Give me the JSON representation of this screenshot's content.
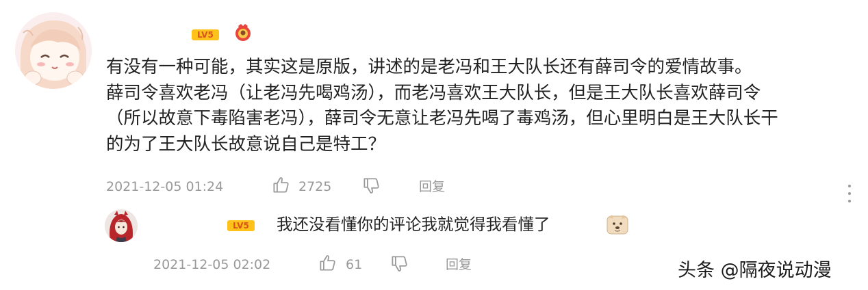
{
  "comment": {
    "level_badge": "LV5",
    "lines": [
      "有没有一种可能，其实这是原版，讲述的是老冯和王大队长还有薛司令的爱情故事。",
      "薛司令喜欢老冯（让老冯先喝鸡汤），而老冯喜欢王大队长，但是王大队长喜欢薛司令",
      "（所以故意下毒陷害老冯），薛司令无意让老冯先喝了毒鸡汤，但心里明白是王大队长干",
      "的为了王大队长故意说自己是特工？"
    ],
    "timestamp": "2021-12-05 01:24",
    "likes": "2725",
    "reply_label": "回复",
    "icons": {
      "avatar": "anime-girl-avatar",
      "medal": "medal-icon",
      "like": "thumbs-up-icon",
      "dislike": "thumbs-down-icon",
      "more": "more-vertical-icon"
    }
  },
  "reply": {
    "level_badge": "LV5",
    "text": "我还没看懂你的评论我就觉得我看懂了",
    "timestamp": "2021-12-05 02:02",
    "likes": "61",
    "reply_label": "回复",
    "icons": {
      "avatar": "red-hair-character-avatar",
      "emoji": "doge-emoji-icon",
      "like": "thumbs-up-icon",
      "dislike": "thumbs-down-icon"
    }
  },
  "watermark": "头条 @隔夜说动漫",
  "colors": {
    "badge_bg": "#ffc21a",
    "badge_text": "#d8541c",
    "meta_text": "#999999",
    "body_text": "#222222"
  }
}
